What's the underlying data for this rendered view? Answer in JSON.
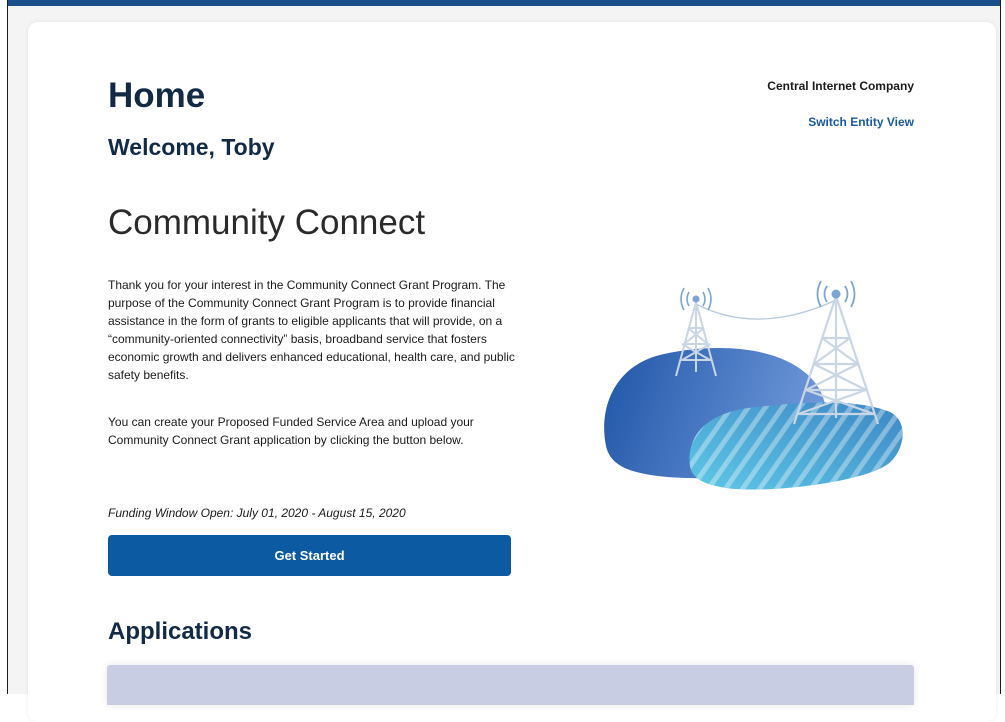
{
  "page": {
    "title": "Home",
    "welcome": "Welcome, Toby"
  },
  "entity": {
    "name": "Central Internet Company",
    "switch_label": "Switch Entity View"
  },
  "program": {
    "title": "Community Connect",
    "intro": "Thank you for your interest in the Community Connect Grant Program. The purpose of the Community Connect Grant Program is to provide financial assistance in the form of grants to eligible applicants that will provide, on a “community-oriented connectivity” basis, broadband service that fosters economic growth and delivers enhanced educational, health care, and public safety benefits.",
    "instructions": "You can create your Proposed Funded Service Area and upload your Community Connect Grant application by clicking the button below.",
    "funding_window": "Funding Window Open: July 01, 2020 - August 15, 2020",
    "cta_label": "Get Started"
  },
  "applications": {
    "heading": "Applications"
  },
  "colors": {
    "brand_blue": "#0b5aa2",
    "heading_navy": "#122a45",
    "link_blue": "#1a5aa0",
    "table_header": "#c8cde4"
  },
  "illustration": {
    "icons": [
      "broadband-tower-icon",
      "signal-waves-icon",
      "hill-icon"
    ]
  }
}
